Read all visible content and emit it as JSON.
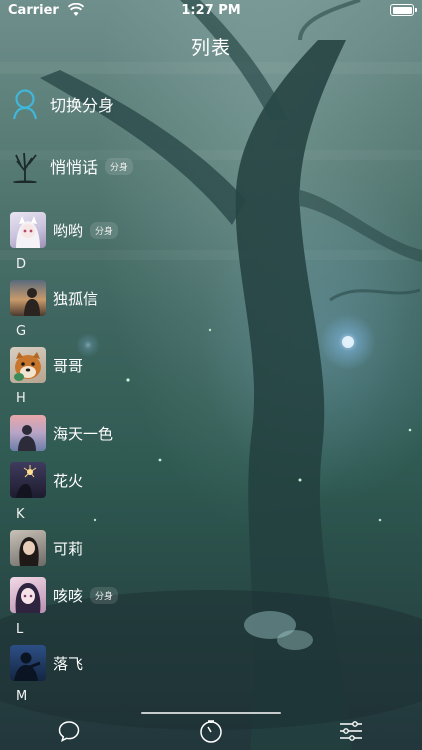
{
  "status_bar": {
    "carrier": "Carrier",
    "time": "1:27 PM"
  },
  "nav": {
    "title": "列表"
  },
  "menu": [
    {
      "label": "切换分身",
      "icon": "person-outline-icon",
      "badge": ""
    },
    {
      "label": "悄悄话",
      "icon": "bare-tree-icon",
      "badge": "分身"
    }
  ],
  "contacts": [
    {
      "name": "哟哟",
      "badge": "分身"
    },
    {
      "name": "独孤信",
      "badge": ""
    },
    {
      "name": "哥哥",
      "badge": ""
    },
    {
      "name": "海天一色",
      "badge": ""
    },
    {
      "name": "花火",
      "badge": ""
    },
    {
      "name": "可莉",
      "badge": ""
    },
    {
      "name": "咳咳",
      "badge": "分身"
    },
    {
      "name": "落飞",
      "badge": ""
    }
  ],
  "section_letters": [
    "D",
    "G",
    "H",
    "K",
    "L",
    "M"
  ],
  "tabs": [
    {
      "name": "chat",
      "icon": "chat-bubble-icon"
    },
    {
      "name": "timer",
      "icon": "stopwatch-icon"
    },
    {
      "name": "settings",
      "icon": "sliders-icon"
    }
  ],
  "colors": {
    "text": "#ffffff",
    "accent": "#3fb7d9"
  }
}
